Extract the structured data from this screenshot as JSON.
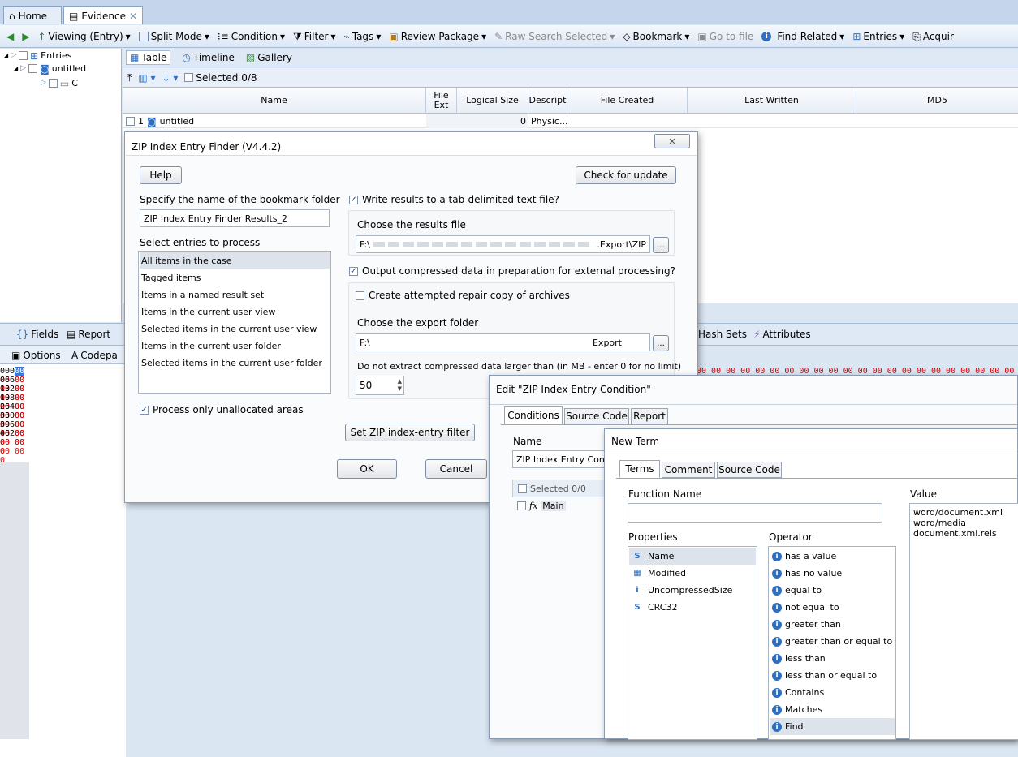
{
  "tabs": {
    "home": "Home",
    "evidence": "Evidence"
  },
  "toolbar": {
    "viewing": "Viewing (Entry)",
    "split_mode": "Split Mode",
    "condition": "Condition",
    "filter": "Filter",
    "tags": "Tags",
    "review_package": "Review Package",
    "raw_search": "Raw Search Selected",
    "bookmark": "Bookmark",
    "go_to_file": "Go to file",
    "find_related": "Find Related",
    "entries": "Entries",
    "acquire": "Acquir"
  },
  "tree": {
    "root": "Entries",
    "child": "untitled",
    "grandchild": "C"
  },
  "view_tabs": {
    "table": "Table",
    "timeline": "Timeline",
    "gallery": "Gallery"
  },
  "subtoolbar": {
    "selected": "Selected 0/8"
  },
  "table": {
    "headers": {
      "name": "Name",
      "file_ext": "File Ext",
      "logical_size": "Logical Size",
      "descript": "Descript",
      "file_created": "File Created",
      "last_written": "Last Written",
      "md5": "MD5"
    },
    "row": {
      "num": "1",
      "name": "untitled",
      "size": "0",
      "descript": "Physic..."
    }
  },
  "lower_tabs": {
    "fields": "Fields",
    "report": "Report",
    "hash_sets": "Hash Sets",
    "attributes": "Attributes"
  },
  "hex_toolbar": {
    "options": "Options",
    "codepage": "Codepa"
  },
  "hex": {
    "offsets": [
      "000",
      "066",
      "132",
      "198",
      "264",
      "330",
      "396",
      "462"
    ],
    "bytes": "00 00 00 00 00 0",
    "right_bytes": "00 00 00 00 00 00 00 00 00 00 00 00 00 00 00 00 00 00 00 00 00 00 00 00 00 00"
  },
  "zip_dialog": {
    "title": "ZIP Index Entry Finder (V4.4.2)",
    "help": "Help",
    "check_update": "Check for update",
    "bookmark_label": "Specify the name of the bookmark folder",
    "bookmark_value": "ZIP Index Entry Finder Results_2",
    "select_label": "Select entries to process",
    "entries": [
      "All items in the case",
      "Tagged items",
      "Items in a named result set",
      "Items in the current user view",
      "Selected items in the current user view",
      "Items in the current user folder",
      "Selected items in the current user folder"
    ],
    "process_unalloc": "Process only unallocated areas",
    "write_results": "Write results to a tab-delimited text file?",
    "choose_results": "Choose the results file",
    "results_path_start": "F:\\",
    "results_path_end": ".Export\\ZIP",
    "browse": "...",
    "output_compressed": "Output compressed data in preparation for external processing?",
    "create_repair": "Create attempted repair copy of archives",
    "choose_export": "Choose the export folder",
    "export_path_start": "F:\\",
    "export_path_end": "Export",
    "limit_label": "Do not extract compressed data larger than (in MB - enter 0 for no limit)",
    "limit_value": "50",
    "set_filter": "Set ZIP index-entry filter",
    "ok": "OK",
    "cancel": "Cancel"
  },
  "edit_dialog": {
    "title": "Edit \"ZIP Index Entry Condition\"",
    "tabs": [
      "Conditions",
      "Source Code",
      "Report"
    ],
    "name_label": "Name",
    "name_value": "ZIP Index Entry Cond",
    "selected": "Selected 0/0",
    "main_node": "Main"
  },
  "new_term": {
    "title": "New Term",
    "tabs": [
      "Terms",
      "Comment",
      "Source Code"
    ],
    "function_label": "Function Name",
    "function_value": "",
    "properties_label": "Properties",
    "properties": [
      {
        "type": "S",
        "name": "Name"
      },
      {
        "type": "cal",
        "name": "Modified"
      },
      {
        "type": "i",
        "name": "UncompressedSize"
      },
      {
        "type": "S",
        "name": "CRC32"
      }
    ],
    "operator_label": "Operator",
    "operators": [
      "has a value",
      "has no value",
      "equal to",
      "not equal to",
      "greater than",
      "greater than or equal to",
      "less than",
      "less than or equal to",
      "Contains",
      "Matches",
      "Find"
    ],
    "value_label": "Value",
    "values": [
      "word/document.xml",
      "word/media",
      "document.xml.rels"
    ]
  }
}
